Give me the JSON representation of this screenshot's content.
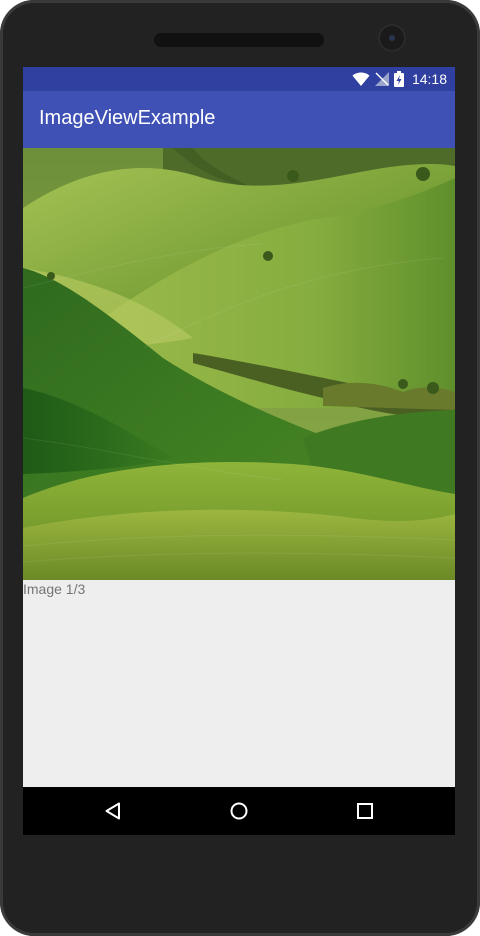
{
  "status_bar": {
    "time": "14:18",
    "icons": [
      "wifi-icon",
      "no-signal-icon",
      "battery-charging-icon"
    ],
    "color": "#3040a0"
  },
  "app_bar": {
    "title": "ImageViewExample",
    "color": "#3f51b5"
  },
  "image_view": {
    "description": "green-hills-landscape",
    "caption": "Image 1/3"
  },
  "nav_bar": {
    "buttons": [
      "back-icon",
      "home-icon",
      "recents-icon"
    ]
  }
}
